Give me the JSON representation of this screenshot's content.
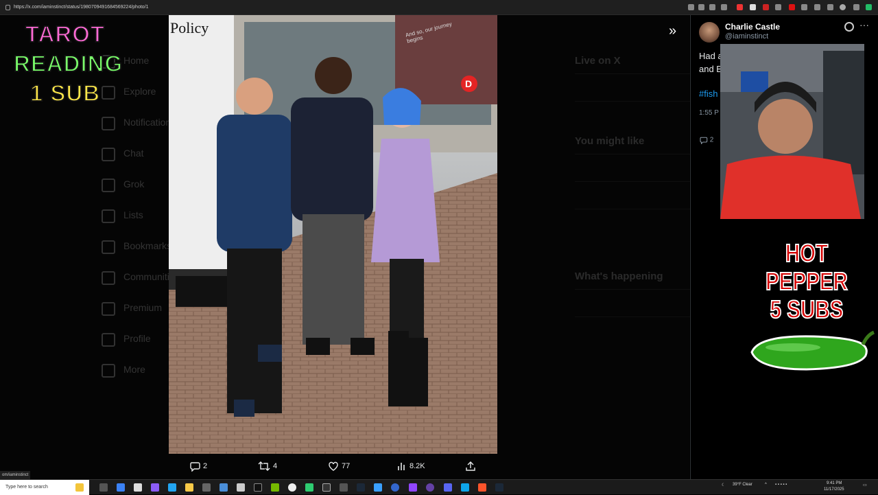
{
  "browser": {
    "url": "https://x.com/iaminstinct/status/1980709491684569224/photo/1",
    "status_text": "om/iaminstinct"
  },
  "overlays": {
    "tarot": {
      "line1": "TAROT",
      "line2": "READING",
      "line3": "1 SUB"
    },
    "hot_pepper": {
      "line1": "HOT",
      "line2": "PEPPER",
      "line3": "5 SUBS"
    }
  },
  "photo_signage": {
    "sign_title": "Policy",
    "banner": "And so, our journey begins",
    "badge": "D"
  },
  "post_actions": {
    "replies": "2",
    "reposts": "4",
    "likes": "77",
    "views": "8.2K"
  },
  "sidebar": {
    "name": "Charlie Castle",
    "handle": "@iaminstinct",
    "tweet_line1": "Had a",
    "tweet_line2": "and B",
    "hashtag": "#fish",
    "time": "1:55 P",
    "reply_count": "2"
  },
  "background_nav": [
    "Home",
    "Explore",
    "Notifications",
    "Chat",
    "Grok",
    "Lists",
    "Bookmarks",
    "Communities",
    "Premium",
    "Profile",
    "More"
  ],
  "background_right": {
    "live": "Live on X",
    "you_might_like": "You might like",
    "whats_happening": "What's happening"
  },
  "taskbar": {
    "search_placeholder": "Type here to search",
    "weather": "39°F Clear",
    "time": "9:41 PM",
    "date": "11/17/2025"
  },
  "colors": {
    "accent": "#1d9bf0",
    "hot_text": "#d40000"
  }
}
